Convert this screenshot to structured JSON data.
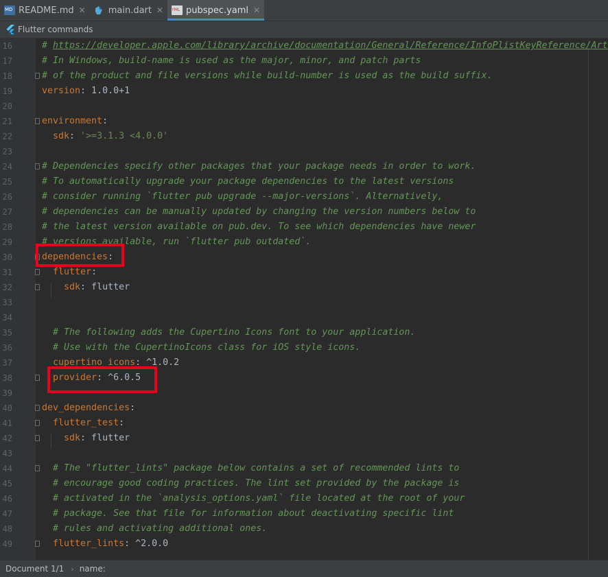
{
  "tabs": [
    {
      "label": "README.md",
      "icon": "markdown-file-icon",
      "active": false
    },
    {
      "label": "main.dart",
      "icon": "dart-file-icon",
      "active": false
    },
    {
      "label": "pubspec.yaml",
      "icon": "yaml-file-icon",
      "active": true
    }
  ],
  "toolbar": {
    "flutter_commands_label": "Flutter commands"
  },
  "editor": {
    "lines": [
      {
        "num": "16",
        "parts": [
          {
            "t": "# ",
            "c": "cm"
          },
          {
            "t": "https://developer.apple.com/library/archive/documentation/General/Reference/InfoPlistKeyReference/Art",
            "c": "cm-link"
          }
        ]
      },
      {
        "num": "17",
        "parts": [
          {
            "t": "# In Windows, build-name is used as the major, minor, and patch parts",
            "c": "cm"
          }
        ]
      },
      {
        "num": "18",
        "parts": [
          {
            "t": "# of the product and file versions while build-number is used as the build suffix.",
            "c": "cm"
          }
        ]
      },
      {
        "num": "19",
        "parts": [
          {
            "t": "version",
            "c": "key"
          },
          {
            "t": ": 1.0.0+1",
            "c": "val"
          }
        ]
      },
      {
        "num": "20",
        "parts": []
      },
      {
        "num": "21",
        "parts": [
          {
            "t": "environment",
            "c": "key"
          },
          {
            "t": ":",
            "c": "val"
          }
        ]
      },
      {
        "num": "22",
        "parts": [
          {
            "t": "  sdk",
            "c": "key"
          },
          {
            "t": ": ",
            "c": "val"
          },
          {
            "t": "'>=3.1.3 <4.0.0'",
            "c": "str"
          }
        ]
      },
      {
        "num": "23",
        "parts": []
      },
      {
        "num": "24",
        "parts": [
          {
            "t": "# Dependencies specify other packages that your package needs in order to work.",
            "c": "cm"
          }
        ]
      },
      {
        "num": "25",
        "parts": [
          {
            "t": "# To automatically upgrade your package dependencies to the latest versions",
            "c": "cm"
          }
        ]
      },
      {
        "num": "26",
        "parts": [
          {
            "t": "# consider running `flutter pub upgrade --major-versions`. Alternatively,",
            "c": "cm"
          }
        ]
      },
      {
        "num": "27",
        "parts": [
          {
            "t": "# dependencies can be manually updated by changing the version numbers below to",
            "c": "cm"
          }
        ]
      },
      {
        "num": "28",
        "parts": [
          {
            "t": "# the latest version available on pub.dev. To see which dependencies have newer",
            "c": "cm"
          }
        ]
      },
      {
        "num": "29",
        "parts": [
          {
            "t": "# versions available, run `flutter pub outdated`.",
            "c": "cm"
          }
        ]
      },
      {
        "num": "30",
        "parts": [
          {
            "t": "dependencies",
            "c": "key"
          },
          {
            "t": ":",
            "c": "val"
          }
        ]
      },
      {
        "num": "31",
        "parts": [
          {
            "t": "  flutter",
            "c": "key"
          },
          {
            "t": ":",
            "c": "val"
          }
        ]
      },
      {
        "num": "32",
        "parts": [
          {
            "t": "    sdk",
            "c": "key"
          },
          {
            "t": ": flutter",
            "c": "val"
          }
        ]
      },
      {
        "num": "33",
        "parts": []
      },
      {
        "num": "34",
        "parts": []
      },
      {
        "num": "35",
        "parts": [
          {
            "t": "  # The following adds the Cupertino Icons font to your application.",
            "c": "cm"
          }
        ]
      },
      {
        "num": "36",
        "parts": [
          {
            "t": "  # Use with the CupertinoIcons class for iOS style icons.",
            "c": "cm"
          }
        ]
      },
      {
        "num": "37",
        "parts": [
          {
            "t": "  cupertino_icons",
            "c": "key"
          },
          {
            "t": ": ^1.0.2",
            "c": "val"
          }
        ]
      },
      {
        "num": "38",
        "parts": [
          {
            "t": "  provider",
            "c": "key"
          },
          {
            "t": ": ^6.0.5",
            "c": "val"
          }
        ]
      },
      {
        "num": "39",
        "parts": []
      },
      {
        "num": "40",
        "parts": [
          {
            "t": "dev_dependencies",
            "c": "key"
          },
          {
            "t": ":",
            "c": "val"
          }
        ]
      },
      {
        "num": "41",
        "parts": [
          {
            "t": "  flutter_test",
            "c": "key"
          },
          {
            "t": ":",
            "c": "val"
          }
        ]
      },
      {
        "num": "42",
        "parts": [
          {
            "t": "    sdk",
            "c": "key"
          },
          {
            "t": ": flutter",
            "c": "val"
          }
        ]
      },
      {
        "num": "43",
        "parts": []
      },
      {
        "num": "44",
        "parts": [
          {
            "t": "  # The \"flutter_lints\" package below contains a set of recommended lints to",
            "c": "cm"
          }
        ]
      },
      {
        "num": "45",
        "parts": [
          {
            "t": "  # encourage good coding practices. The lint set provided by the package is",
            "c": "cm"
          }
        ]
      },
      {
        "num": "46",
        "parts": [
          {
            "t": "  # activated in the `analysis_options.yaml` file located at the root of your",
            "c": "cm"
          }
        ]
      },
      {
        "num": "47",
        "parts": [
          {
            "t": "  # package. See that file for information about deactivating specific lint",
            "c": "cm"
          }
        ]
      },
      {
        "num": "48",
        "parts": [
          {
            "t": "  # rules and activating additional ones.",
            "c": "cm"
          }
        ]
      },
      {
        "num": "49",
        "parts": [
          {
            "t": "  flutter_lints",
            "c": "key"
          },
          {
            "t": ": ^2.0.0",
            "c": "val"
          }
        ]
      }
    ]
  },
  "statusbar": {
    "document": "Document 1/1",
    "path": "name:"
  },
  "colors": {
    "editor_bg": "#2b2b2b",
    "comment": "#629755",
    "key": "#cc7832",
    "value": "#a9b7c6",
    "string": "#6a8759",
    "highlight": "#e8001c"
  }
}
